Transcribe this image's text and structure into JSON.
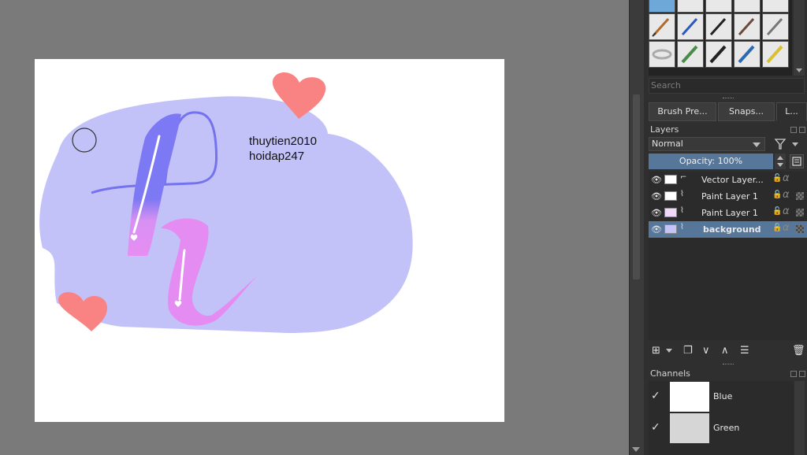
{
  "canvas": {
    "text_line1": "thuytien2010",
    "text_line2": "hoidap247"
  },
  "brush_presets": {
    "search_placeholder": "Search"
  },
  "docker_tabs": [
    "Brush Pre...",
    "Snaps...",
    "L..."
  ],
  "layers_panel": {
    "title": "Layers",
    "blend_mode": "Normal",
    "opacity_label": "Opacity:  100%",
    "layers": [
      {
        "name": "Vector Layer...",
        "selected": false
      },
      {
        "name": "Paint Layer 1",
        "selected": false
      },
      {
        "name": "Paint Layer 1",
        "selected": false
      },
      {
        "name": "background",
        "selected": true
      }
    ]
  },
  "channels_panel": {
    "title": "Channels",
    "channels": [
      "Blue",
      "Green"
    ]
  },
  "glyphs": {
    "eye": "👁",
    "lock": "🔓",
    "alpha": "α",
    "check": "✓",
    "add": "⊞",
    "duplicate": "❐",
    "move_down": "∨",
    "move_up": "∧",
    "properties": "☰",
    "delete": "🗑",
    "filter": "⏷"
  },
  "colors": {
    "accent": "#56769a",
    "blob": "#c4c4f8",
    "heart": "#f97a7e",
    "stroke_blue": "#7a78f0",
    "stroke_pink": "#e98cf0"
  }
}
